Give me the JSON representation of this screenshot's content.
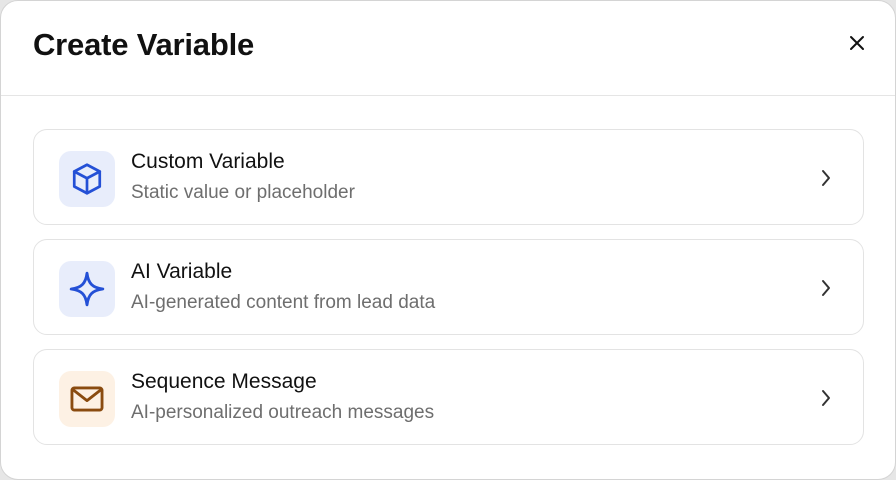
{
  "dialog": {
    "title": "Create Variable",
    "close_icon": "close-icon"
  },
  "options": [
    {
      "title": "Custom Variable",
      "description": "Static value or placeholder",
      "icon": "cube-icon",
      "accent": "#2450d6",
      "tile_bg": "#e8edfb"
    },
    {
      "title": "AI Variable",
      "description": "AI-generated content from lead data",
      "icon": "sparkle-icon",
      "accent": "#2450d6",
      "tile_bg": "#e8edfb"
    },
    {
      "title": "Sequence Message",
      "description": "AI-personalized outreach messages",
      "icon": "mail-icon",
      "accent": "#8a4b0f",
      "tile_bg": "#fdf1e4"
    }
  ]
}
